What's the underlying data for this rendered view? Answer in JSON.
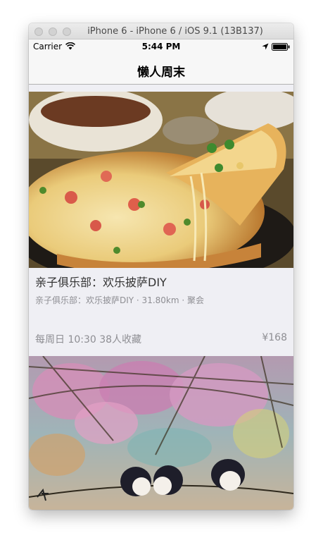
{
  "window": {
    "title": "iPhone 6 - iPhone 6 / iOS 9.1 (13B137)"
  },
  "status_bar": {
    "carrier": "Carrier",
    "time": "5:44 PM"
  },
  "nav": {
    "title": "懒人周末"
  },
  "events": [
    {
      "title": "亲子俱乐部：欢乐披萨DIY",
      "subtitle": "亲子俱乐部：欢乐披萨DIY · 31.80km · 聚会",
      "time_favorites": "每周日 10:30  38人收藏",
      "price": "¥168",
      "image": "pizza-photo"
    },
    {
      "image": "painting-birds-wisteria"
    }
  ],
  "colors": {
    "background": "#efeff4",
    "bar": "#f7f7f7",
    "secondary_text": "#8e8e93"
  }
}
